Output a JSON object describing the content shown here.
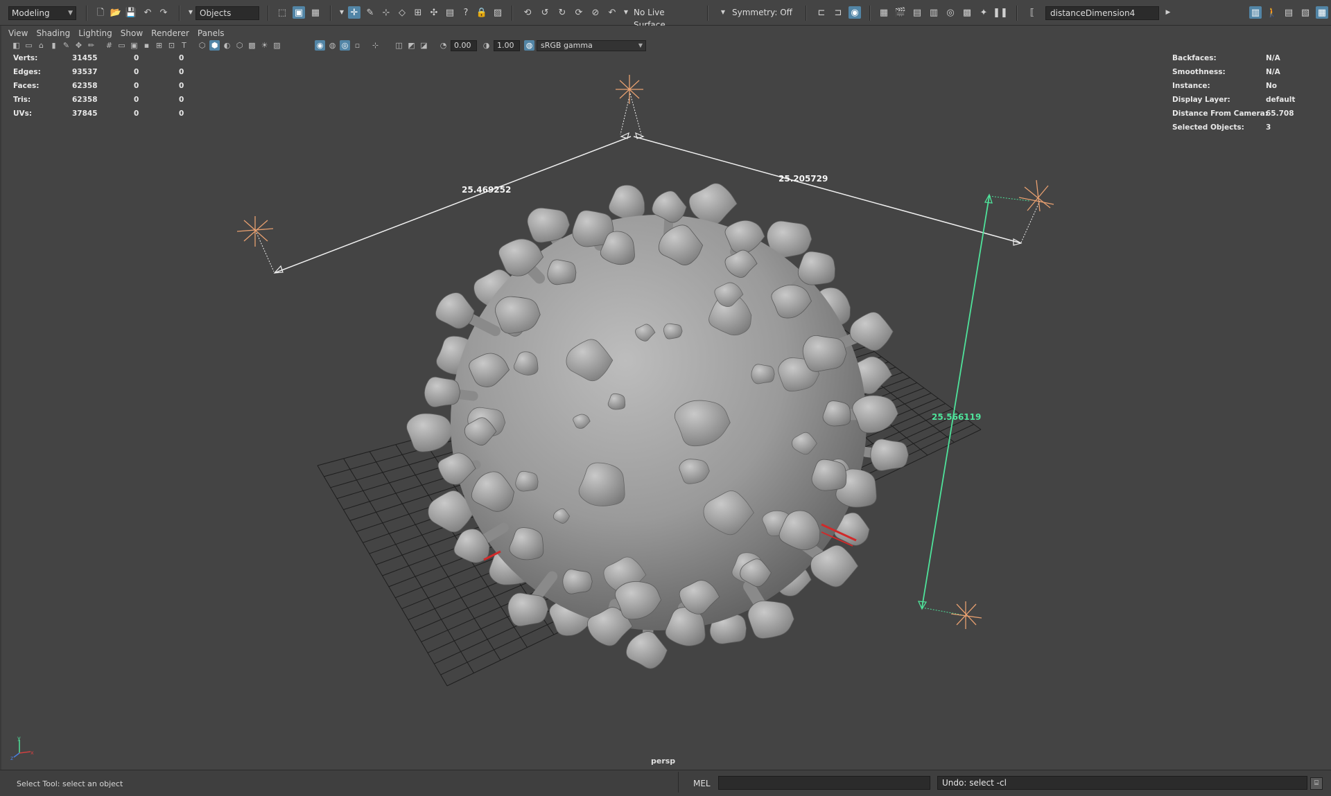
{
  "status_line": {
    "mode": "Modeling",
    "selection_mask": "Objects",
    "live_surface": "No Live Surface",
    "symmetry": "Symmetry: Off",
    "rename_field": "distanceDimension4",
    "icons": [
      "new-scene-icon",
      "open-scene-icon",
      "save-scene-icon",
      "undo-icon",
      "redo-icon",
      "select-by-hierarchy-icon",
      "select-by-object-icon",
      "select-by-component-icon",
      "snap-to-grid-icon",
      "snap-to-curve-icon",
      "snap-to-point-icon",
      "snap-to-view-plane-icon",
      "lock-icon",
      "render-icon",
      "ipr-render-icon",
      "render-settings-icon",
      "hypershade-icon"
    ]
  },
  "panel_menu": [
    "View",
    "Shading",
    "Lighting",
    "Show",
    "Renderer",
    "Panels"
  ],
  "panel_toolbar": {
    "exposure": "0.00",
    "gamma": "1.00",
    "color_space": "sRGB gamma"
  },
  "hud_left": [
    {
      "label": "Verts:",
      "v1": "31455",
      "v2": "0",
      "v3": "0"
    },
    {
      "label": "Edges:",
      "v1": "93537",
      "v2": "0",
      "v3": "0"
    },
    {
      "label": "Faces:",
      "v1": "62358",
      "v2": "0",
      "v3": "0"
    },
    {
      "label": "Tris:",
      "v1": "62358",
      "v2": "0",
      "v3": "0"
    },
    {
      "label": "UVs:",
      "v1": "37845",
      "v2": "0",
      "v3": "0"
    }
  ],
  "hud_right": [
    {
      "label": "Backfaces:",
      "value": "N/A"
    },
    {
      "label": "Smoothness:",
      "value": "N/A"
    },
    {
      "label": "Instance:",
      "value": "No"
    },
    {
      "label": "Display Layer:",
      "value": "default"
    },
    {
      "label": "Distance From Camera:",
      "value": "65.708"
    },
    {
      "label": "Selected Objects:",
      "value": "3"
    }
  ],
  "dimensions": {
    "left": "25.469252",
    "right": "25.205729",
    "vertical": "25.566119"
  },
  "camera_name": "persp",
  "colors": {
    "viewport_bg": "#444444",
    "locator": "#e8a070",
    "measure_line": "#f0f0f0",
    "selected_measure": "#4fe39b",
    "highlight": "#5285a6"
  },
  "command_line": {
    "help_text": "Select Tool: select an object",
    "language": "MEL",
    "result": "Undo: select -cl"
  }
}
